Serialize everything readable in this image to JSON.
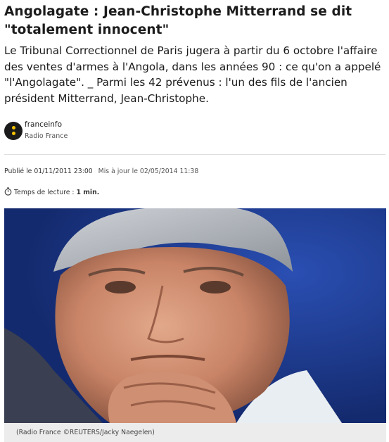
{
  "article": {
    "title": "Angolagate : Jean-Christophe Mitterrand se dit \"totalement innocent\"",
    "chapo": "Le Tribunal Correctionnel de Paris jugera à partir du 6 octobre l'affaire des ventes d'armes à l'Angola, dans les années 90 : ce qu'on a appelé \"l'Angolagate\". _ Parmi les 42 prévenus : l'un des fils de l'ancien président Mitterrand, Jean-Christophe."
  },
  "source": {
    "name": "franceinfo",
    "sub": "Radio France",
    "logo_icon": "franceinfo-logo-icon",
    "logo_colors": {
      "bg": "#1b1b1b",
      "dot": "#f5c400"
    }
  },
  "dates": {
    "published": "Publié le 01/11/2011 23:00",
    "updated": "Mis à jour le 02/05/2014 11:38"
  },
  "reading": {
    "icon": "stopwatch-icon",
    "label": "Temps de lecture :",
    "value": "1 min."
  },
  "image": {
    "caption": "(Radio France ©REUTERS/Jacky Naegelen)",
    "background": "#1f3a8c"
  }
}
